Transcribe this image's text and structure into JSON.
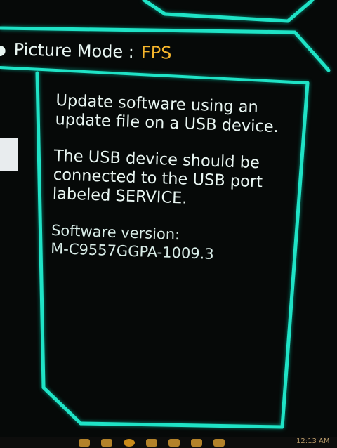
{
  "picture_mode": {
    "label": "Picture Mode :",
    "value": "FPS"
  },
  "info": {
    "paragraph1": "Update software using an update file on a USB device.",
    "paragraph2": "The USB device should be connected to the USB port labeled SERVICE.",
    "version_label": "Software version:",
    "version_value": "M-C9557GGPA-1009.3"
  },
  "taskbar": {
    "clock": "12:13 AM",
    "icons": [
      "tray-icon-1",
      "tray-icon-2",
      "tray-icon-3",
      "tray-icon-4",
      "tray-icon-5",
      "tray-icon-6",
      "tray-icon-7"
    ]
  },
  "colors": {
    "frame": "#1fe3c6",
    "text": "#e9f6f2",
    "mode_value": "#f5b52c",
    "background": "#060908"
  }
}
